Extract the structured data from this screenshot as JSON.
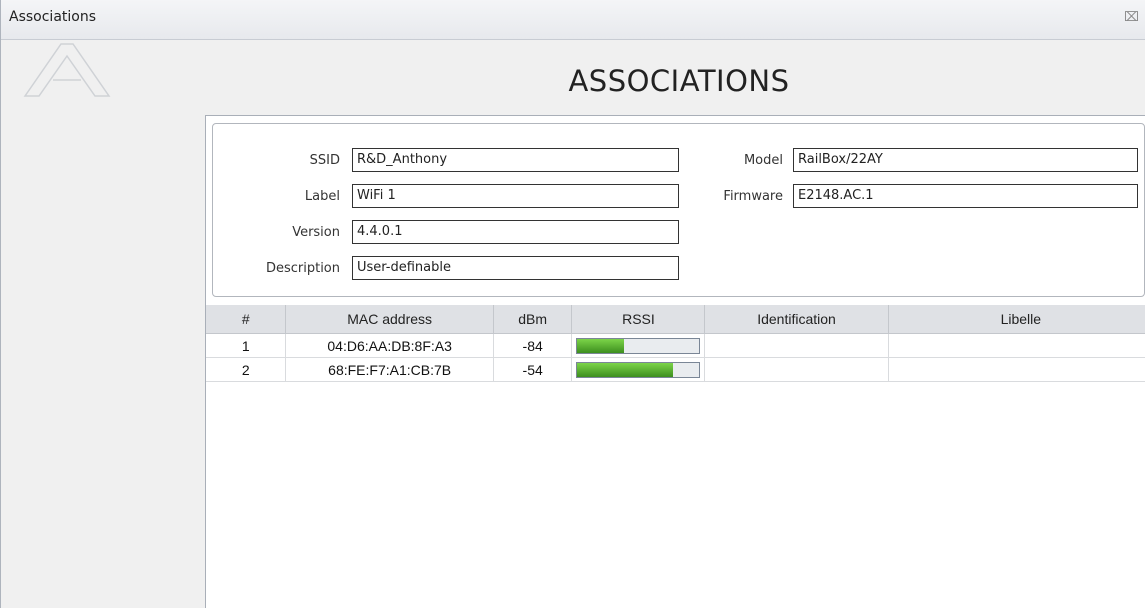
{
  "window": {
    "title": "Associations",
    "close_glyph": "⌧"
  },
  "page": {
    "heading": "ASSOCIATIONS"
  },
  "info": {
    "ssid_label": "SSID",
    "ssid_value": "R&D_Anthony",
    "label_label": "Label",
    "label_value": "WiFi 1",
    "version_label": "Version",
    "version_value": "4.4.0.1",
    "description_label": "Description",
    "description_value": "User-definable",
    "model_label": "Model",
    "model_value": "RailBox/22AY",
    "firmware_label": "Firmware",
    "firmware_value": "E2148.AC.1"
  },
  "table": {
    "columns": [
      "#",
      "MAC address",
      "dBm",
      "RSSI",
      "Identification",
      "Libelle"
    ],
    "rows": [
      {
        "num": "1",
        "mac": "04:D6:AA:DB:8F:A3",
        "dbm": "-84",
        "rssi_fraction": 0.38,
        "identification": "",
        "libelle": ""
      },
      {
        "num": "2",
        "mac": "68:FE:F7:A1:CB:7B",
        "dbm": "-54",
        "rssi_fraction": 0.78,
        "identification": "",
        "libelle": ""
      }
    ]
  },
  "colors": {
    "rssi_bar_top": "#7cd449",
    "rssi_bar_bottom": "#3d8f1e",
    "header_bg": "#dfe1e5"
  },
  "icons": {
    "logo": "app-logo-icon",
    "close": "close-icon"
  }
}
